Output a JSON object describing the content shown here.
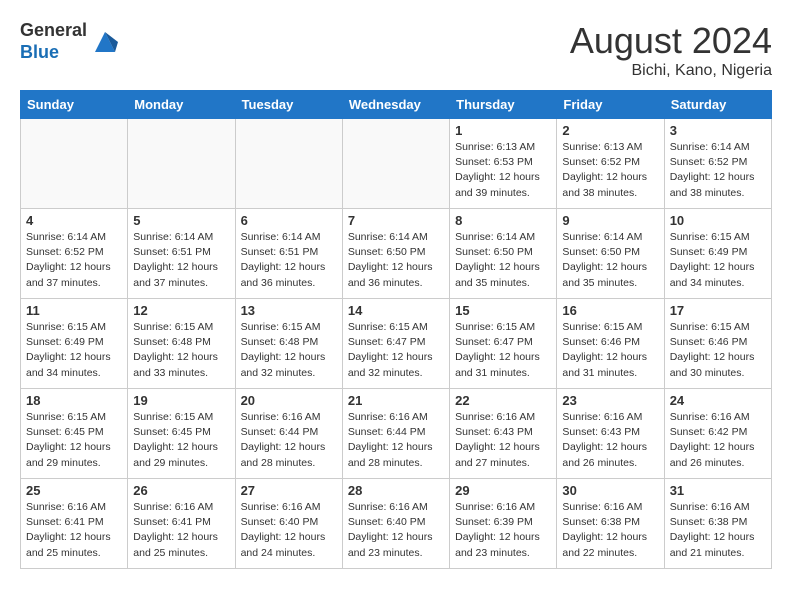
{
  "header": {
    "logo_general": "General",
    "logo_blue": "Blue",
    "month_year": "August 2024",
    "location": "Bichi, Kano, Nigeria"
  },
  "weekdays": [
    "Sunday",
    "Monday",
    "Tuesday",
    "Wednesday",
    "Thursday",
    "Friday",
    "Saturday"
  ],
  "weeks": [
    [
      {
        "day": "",
        "info": ""
      },
      {
        "day": "",
        "info": ""
      },
      {
        "day": "",
        "info": ""
      },
      {
        "day": "",
        "info": ""
      },
      {
        "day": "1",
        "info": "Sunrise: 6:13 AM\nSunset: 6:53 PM\nDaylight: 12 hours and 39 minutes."
      },
      {
        "day": "2",
        "info": "Sunrise: 6:13 AM\nSunset: 6:52 PM\nDaylight: 12 hours and 38 minutes."
      },
      {
        "day": "3",
        "info": "Sunrise: 6:14 AM\nSunset: 6:52 PM\nDaylight: 12 hours and 38 minutes."
      }
    ],
    [
      {
        "day": "4",
        "info": "Sunrise: 6:14 AM\nSunset: 6:52 PM\nDaylight: 12 hours and 37 minutes."
      },
      {
        "day": "5",
        "info": "Sunrise: 6:14 AM\nSunset: 6:51 PM\nDaylight: 12 hours and 37 minutes."
      },
      {
        "day": "6",
        "info": "Sunrise: 6:14 AM\nSunset: 6:51 PM\nDaylight: 12 hours and 36 minutes."
      },
      {
        "day": "7",
        "info": "Sunrise: 6:14 AM\nSunset: 6:50 PM\nDaylight: 12 hours and 36 minutes."
      },
      {
        "day": "8",
        "info": "Sunrise: 6:14 AM\nSunset: 6:50 PM\nDaylight: 12 hours and 35 minutes."
      },
      {
        "day": "9",
        "info": "Sunrise: 6:14 AM\nSunset: 6:50 PM\nDaylight: 12 hours and 35 minutes."
      },
      {
        "day": "10",
        "info": "Sunrise: 6:15 AM\nSunset: 6:49 PM\nDaylight: 12 hours and 34 minutes."
      }
    ],
    [
      {
        "day": "11",
        "info": "Sunrise: 6:15 AM\nSunset: 6:49 PM\nDaylight: 12 hours and 34 minutes."
      },
      {
        "day": "12",
        "info": "Sunrise: 6:15 AM\nSunset: 6:48 PM\nDaylight: 12 hours and 33 minutes."
      },
      {
        "day": "13",
        "info": "Sunrise: 6:15 AM\nSunset: 6:48 PM\nDaylight: 12 hours and 32 minutes."
      },
      {
        "day": "14",
        "info": "Sunrise: 6:15 AM\nSunset: 6:47 PM\nDaylight: 12 hours and 32 minutes."
      },
      {
        "day": "15",
        "info": "Sunrise: 6:15 AM\nSunset: 6:47 PM\nDaylight: 12 hours and 31 minutes."
      },
      {
        "day": "16",
        "info": "Sunrise: 6:15 AM\nSunset: 6:46 PM\nDaylight: 12 hours and 31 minutes."
      },
      {
        "day": "17",
        "info": "Sunrise: 6:15 AM\nSunset: 6:46 PM\nDaylight: 12 hours and 30 minutes."
      }
    ],
    [
      {
        "day": "18",
        "info": "Sunrise: 6:15 AM\nSunset: 6:45 PM\nDaylight: 12 hours and 29 minutes."
      },
      {
        "day": "19",
        "info": "Sunrise: 6:15 AM\nSunset: 6:45 PM\nDaylight: 12 hours and 29 minutes."
      },
      {
        "day": "20",
        "info": "Sunrise: 6:16 AM\nSunset: 6:44 PM\nDaylight: 12 hours and 28 minutes."
      },
      {
        "day": "21",
        "info": "Sunrise: 6:16 AM\nSunset: 6:44 PM\nDaylight: 12 hours and 28 minutes."
      },
      {
        "day": "22",
        "info": "Sunrise: 6:16 AM\nSunset: 6:43 PM\nDaylight: 12 hours and 27 minutes."
      },
      {
        "day": "23",
        "info": "Sunrise: 6:16 AM\nSunset: 6:43 PM\nDaylight: 12 hours and 26 minutes."
      },
      {
        "day": "24",
        "info": "Sunrise: 6:16 AM\nSunset: 6:42 PM\nDaylight: 12 hours and 26 minutes."
      }
    ],
    [
      {
        "day": "25",
        "info": "Sunrise: 6:16 AM\nSunset: 6:41 PM\nDaylight: 12 hours and 25 minutes."
      },
      {
        "day": "26",
        "info": "Sunrise: 6:16 AM\nSunset: 6:41 PM\nDaylight: 12 hours and 25 minutes."
      },
      {
        "day": "27",
        "info": "Sunrise: 6:16 AM\nSunset: 6:40 PM\nDaylight: 12 hours and 24 minutes."
      },
      {
        "day": "28",
        "info": "Sunrise: 6:16 AM\nSunset: 6:40 PM\nDaylight: 12 hours and 23 minutes."
      },
      {
        "day": "29",
        "info": "Sunrise: 6:16 AM\nSunset: 6:39 PM\nDaylight: 12 hours and 23 minutes."
      },
      {
        "day": "30",
        "info": "Sunrise: 6:16 AM\nSunset: 6:38 PM\nDaylight: 12 hours and 22 minutes."
      },
      {
        "day": "31",
        "info": "Sunrise: 6:16 AM\nSunset: 6:38 PM\nDaylight: 12 hours and 21 minutes."
      }
    ]
  ]
}
